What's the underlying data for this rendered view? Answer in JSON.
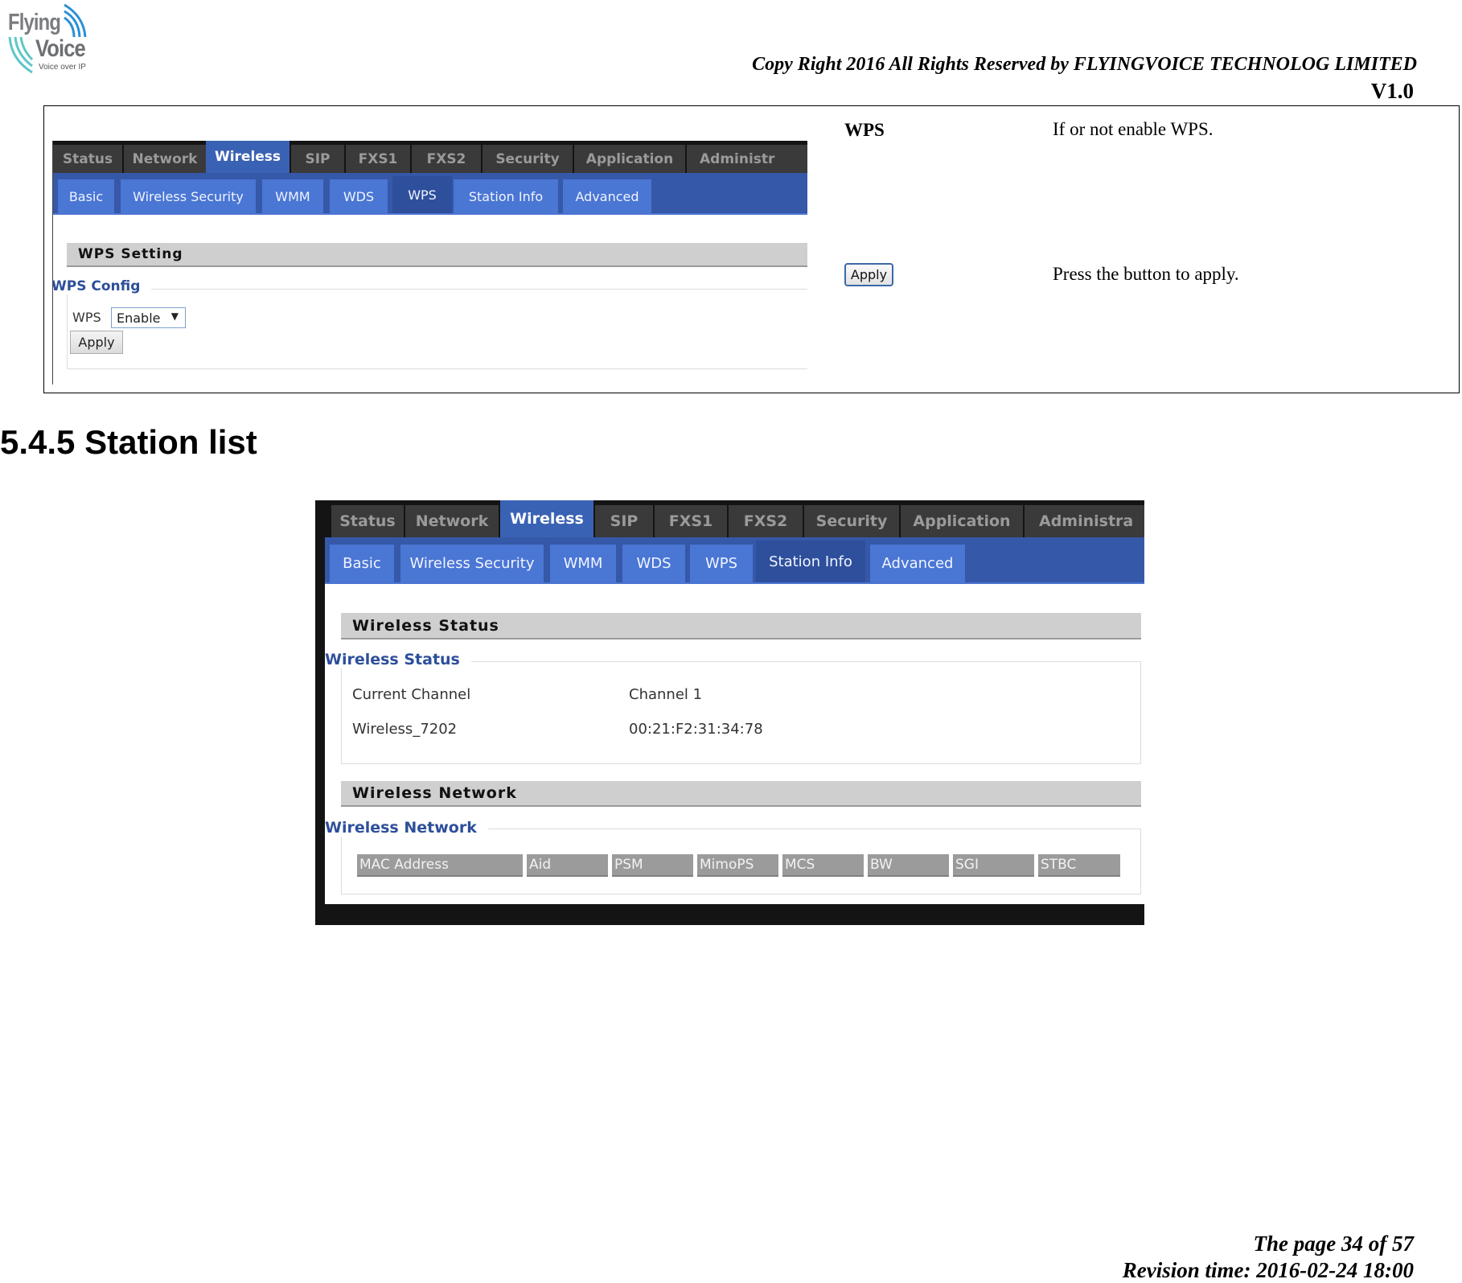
{
  "header": {
    "logo": {
      "line1": "Flying",
      "line2": "Voice",
      "tagline": "Voice over IP"
    },
    "copyright": "Copy Right 2016 All Rights Reserved by FLYINGVOICE TECHNOLOG LIMITED",
    "version": "V1.0"
  },
  "wps_table": {
    "screenshot": {
      "main_tabs": [
        "Status",
        "Network",
        "Wireless",
        "SIP",
        "FXS1",
        "FXS2",
        "Security",
        "Application",
        "Administr"
      ],
      "active_main_tab": "Wireless",
      "sub_tabs": [
        "Basic",
        "Wireless Security",
        "WMM",
        "WDS",
        "WPS",
        "Station Info",
        "Advanced"
      ],
      "active_sub_tab": "WPS",
      "section_title": "WPS Setting",
      "fieldset_legend": "WPS Config",
      "wps_label": "WPS",
      "wps_select_value": "Enable",
      "apply_button": "Apply"
    },
    "rows": [
      {
        "field": "WPS",
        "description": "If or not enable WPS."
      },
      {
        "field_button": "Apply",
        "description": "Press the button to apply."
      }
    ]
  },
  "section_heading": "5.4.5 Station list",
  "station_screenshot": {
    "main_tabs": [
      "Status",
      "Network",
      "Wireless",
      "SIP",
      "FXS1",
      "FXS2",
      "Security",
      "Application",
      "Administra"
    ],
    "active_main_tab": "Wireless",
    "sub_tabs": [
      "Basic",
      "Wireless Security",
      "WMM",
      "WDS",
      "WPS",
      "Station Info",
      "Advanced"
    ],
    "active_sub_tab": "Station Info",
    "wireless_status": {
      "section_title": "Wireless Status",
      "legend": "Wireless Status",
      "rows": [
        {
          "label": "Current Channel",
          "value": "Channel 1"
        },
        {
          "label": "Wireless_7202",
          "value": "00:21:F2:31:34:78"
        }
      ]
    },
    "wireless_network": {
      "section_title": "Wireless Network",
      "legend": "Wireless Network",
      "columns": [
        "MAC Address",
        "Aid",
        "PSM",
        "MimoPS",
        "MCS",
        "BW",
        "SGI",
        "STBC"
      ]
    }
  },
  "footer": {
    "page": "The page 34 of 57",
    "revision": "Revision time: 2016-02-24 18:00"
  }
}
